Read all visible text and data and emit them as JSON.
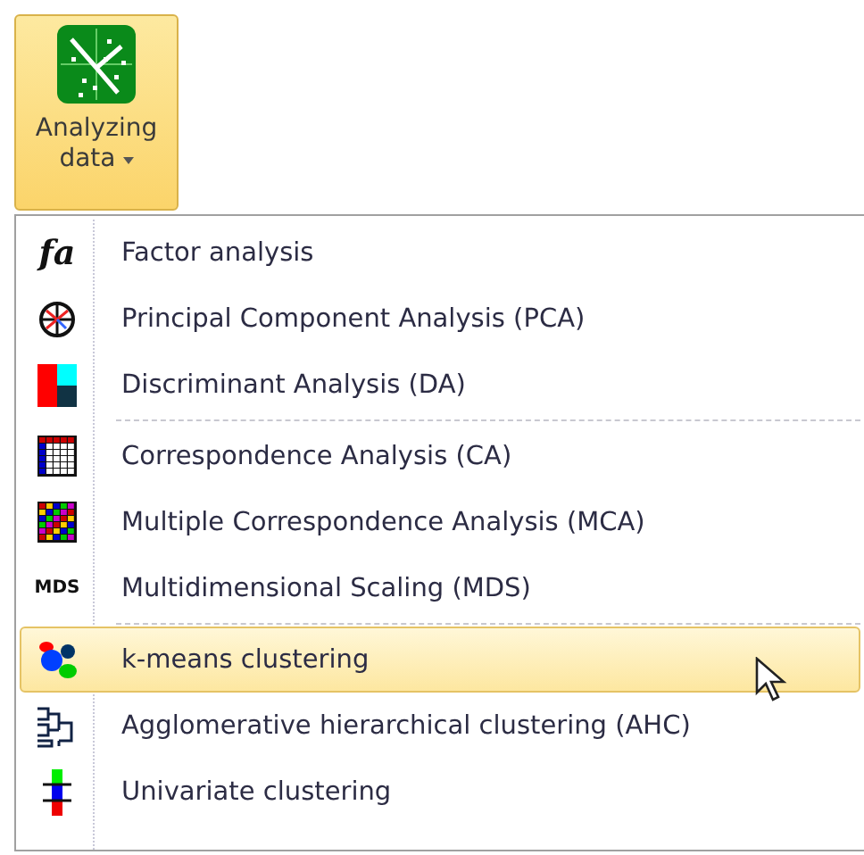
{
  "ribbon_button": {
    "label_lines": [
      "Analyzing",
      "data"
    ],
    "expanded": true
  },
  "menu": {
    "groups": [
      [
        {
          "kind": "fa",
          "icon_text": "fa",
          "label": "Factor analysis",
          "selected": false
        },
        {
          "kind": "pca",
          "label": "Principal Component Analysis (PCA)",
          "selected": false
        },
        {
          "kind": "da",
          "label": "Discriminant Analysis (DA)",
          "selected": false
        }
      ],
      [
        {
          "kind": "ca",
          "label": "Correspondence Analysis (CA)",
          "selected": false
        },
        {
          "kind": "mca",
          "label": "Multiple Correspondence Analysis (MCA)",
          "selected": false
        },
        {
          "kind": "mds",
          "icon_text": "MDS",
          "label": "Multidimensional Scaling (MDS)",
          "selected": false
        }
      ],
      [
        {
          "kind": "kmeans",
          "label": "k-means clustering",
          "selected": true
        },
        {
          "kind": "ahc",
          "label": "Agglomerative hierarchical clustering (AHC)",
          "selected": false
        },
        {
          "kind": "univariate",
          "label": "Univariate clustering",
          "selected": false
        }
      ]
    ]
  }
}
